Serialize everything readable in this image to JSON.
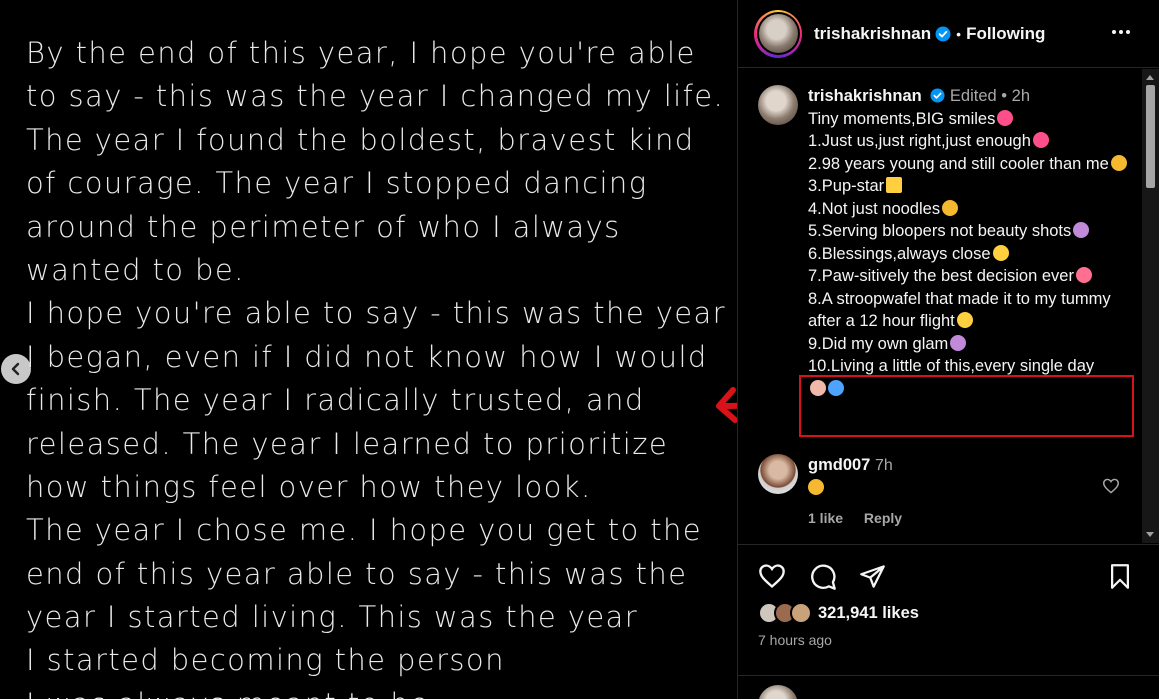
{
  "media": {
    "lines": [
      "By the end of this year, I hope you're able",
      "to say - this was the year I changed my life.",
      "The year I found the boldest, bravest kind",
      "of courage. The year I stopped dancing",
      "around the perimeter of who I always",
      "wanted to be.",
      "I hope you're able to say - this was the year",
      "I began, even if I did not know how I would",
      "finish. The year I radically trusted, and",
      "released. The year I learned to prioritize",
      "how things feel over how they look.",
      "The year I chose me. I hope you get to the",
      "end of this year able to say - this was the",
      "year I started living. This was the year",
      "I started becoming the person",
      "I was always meant to be."
    ]
  },
  "header": {
    "username": "trishakrishnan",
    "separator": "•",
    "follow_status": "Following"
  },
  "caption": {
    "username": "trishakrishnan",
    "edited": "Edited",
    "separator": "•",
    "time": "2h",
    "title": "Tiny moments,BIG smiles",
    "items": [
      "1.Just us,just right,just enough",
      "2.98 years young and still cooler than me",
      "3.Pup-star",
      "4.Not just noodles",
      "5.Serving bloopers not beauty shots",
      "6.Blessings,always close",
      "7.Paw-sitively the best decision ever",
      "8.A stroopwafel that made it to my tummy after a 12 hour flight",
      "9.Did my own glam",
      "10.Living a little of this,every single day"
    ],
    "emoji_colors": [
      "#ff4f8b",
      "#ff4f8b",
      "#f5b82e",
      "#ffcf40",
      "#f5b82e",
      "#c08ad8",
      "#ffcf40",
      "#ff6f91",
      "#ffcf40",
      "#c08ad8",
      "#4da3ff"
    ],
    "icons": [
      "two-hearts-icon",
      "pink-heart-icon",
      "sunglasses-face-icon",
      "star-icon",
      "tongue-face-icon",
      "tipping-hand-icon",
      "halo-face-icon",
      "heart-ribbon-icon",
      "pleading-face-icon",
      "selfie-icon",
      "palms-up-icon",
      "evil-eye-icon"
    ]
  },
  "comment": {
    "username": "gmd007",
    "time": "7h",
    "likes": "1 like",
    "reply": "Reply"
  },
  "stats": {
    "likes": "321,941 likes",
    "time_ago": "7 hours ago"
  },
  "colors": {
    "verified": "#0095f6",
    "highlight": "#d81219",
    "muted": "#a8a8a8"
  }
}
